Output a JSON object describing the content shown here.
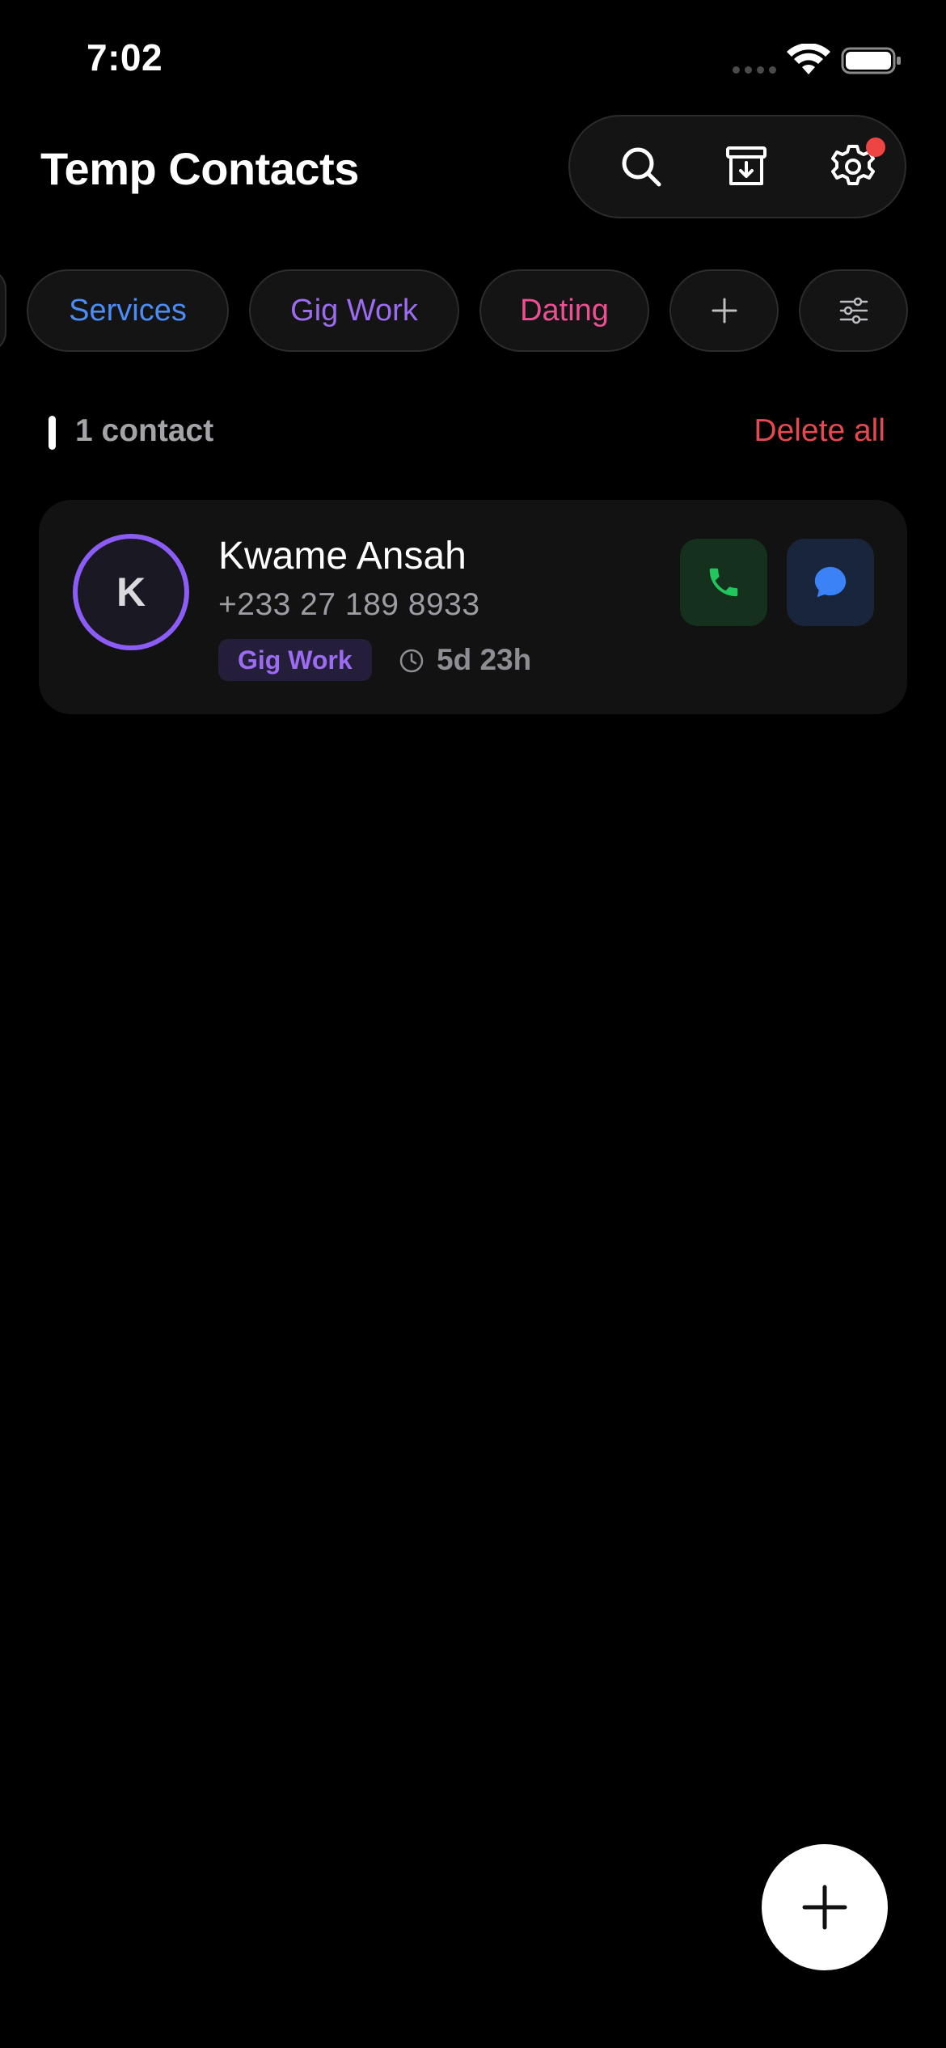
{
  "status_bar": {
    "time": "7:02"
  },
  "header": {
    "title": "Temp Contacts",
    "actions": [
      "search-icon",
      "archive-icon",
      "settings-icon"
    ],
    "settings_has_notification": true
  },
  "filters": {
    "chips": [
      {
        "label": "Services",
        "color": "#4b8df5"
      },
      {
        "label": "Gig Work",
        "color": "#9b6cf0"
      },
      {
        "label": "Dating",
        "color": "#ec4f92"
      }
    ],
    "add_icon": "plus-icon",
    "filter_icon": "sliders-icon"
  },
  "list": {
    "count_label": "1 contact",
    "delete_all_label": "Delete all"
  },
  "contacts": [
    {
      "initial": "K",
      "name": "Kwame Ansah",
      "phone": "+233 27 189 8933",
      "tag": "Gig Work",
      "expires_in": "5d 23h"
    }
  ],
  "colors": {
    "background": "#000000",
    "accent_purple": "#8b5cf6",
    "delete_red": "#e5484d",
    "call_green": "#22c55e",
    "message_blue": "#3b82f6"
  }
}
